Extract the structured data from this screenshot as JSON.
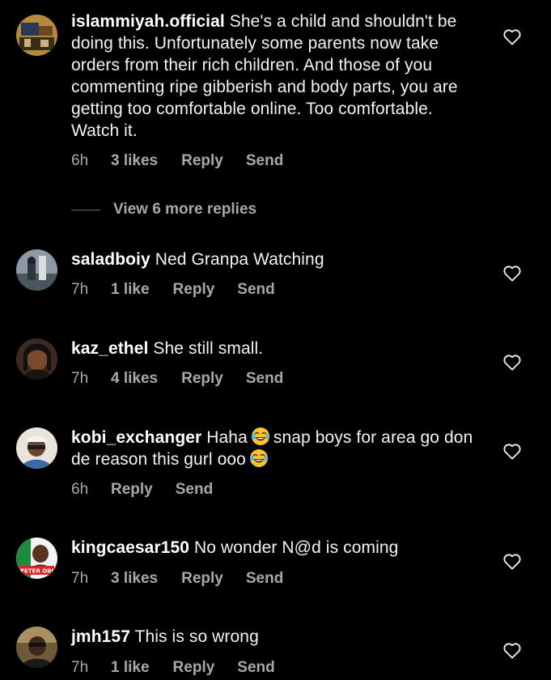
{
  "comments": [
    {
      "username": "islammiyah.official",
      "text": "She's a child and shouldn't be doing this. Unfortunately some parents now take orders from their rich children. And those of you commenting ripe gibberish and body parts, you are getting too comfortable online. Too comfortable. Watch it.",
      "time": "6h",
      "likes": "3 likes",
      "reply": "Reply",
      "send": "Send"
    },
    {
      "username": "saladboiy",
      "text": "Ned Granpa Watching",
      "time": "7h",
      "likes": "1 like",
      "reply": "Reply",
      "send": "Send"
    },
    {
      "username": "kaz_ethel",
      "text": "She still small.",
      "time": "7h",
      "likes": "4 likes",
      "reply": "Reply",
      "send": "Send"
    },
    {
      "username": "kobi_exchanger",
      "text_part1": "Haha",
      "text_part2": "snap boys for area go don de reason this  gurl ooo",
      "time": "6h",
      "reply": "Reply",
      "send": "Send"
    },
    {
      "username": "kingcaesar150",
      "text": "No wonder N@d is coming",
      "avatar_text": "PETER OBI",
      "time": "7h",
      "likes": "3 likes",
      "reply": "Reply",
      "send": "Send"
    },
    {
      "username": "jmh157",
      "text": "This is so wrong",
      "time": "7h",
      "likes": "1 like",
      "reply": "Reply",
      "send": "Send"
    }
  ],
  "view_more_replies": "View 6 more replies",
  "icons": {
    "like": "heart-outline-icon",
    "emoji": "face-with-tears-of-joy-emoji"
  },
  "colors": {
    "background": "#000000",
    "text": "#f2f2f2",
    "meta": "#a8a8a8"
  }
}
